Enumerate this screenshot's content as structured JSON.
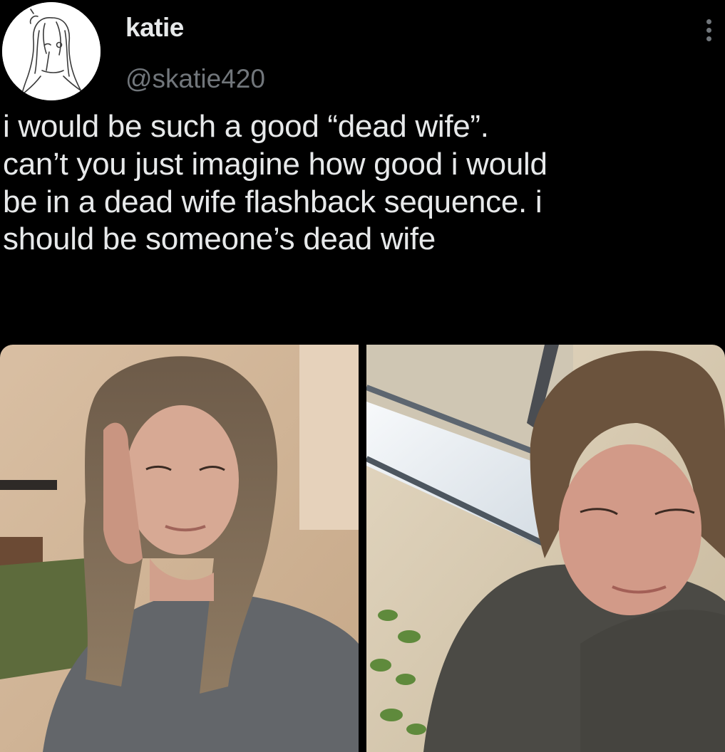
{
  "user": {
    "display_name": "katie",
    "handle": "@skatie420",
    "avatar_icon": "sketch-portrait-avatar"
  },
  "menu": {
    "icon": "more-vertical-icon"
  },
  "tweet": {
    "lines": [
      "i would be such a good “dead wife”.",
      "can’t you just imagine how good i would",
      "be in a dead wife flashback sequence. i",
      "should be someone’s dead wife"
    ]
  },
  "media": {
    "count": 2
  },
  "colors": {
    "background": "#000000",
    "text": "#e7e9ea",
    "secondary_text": "#71767b"
  }
}
